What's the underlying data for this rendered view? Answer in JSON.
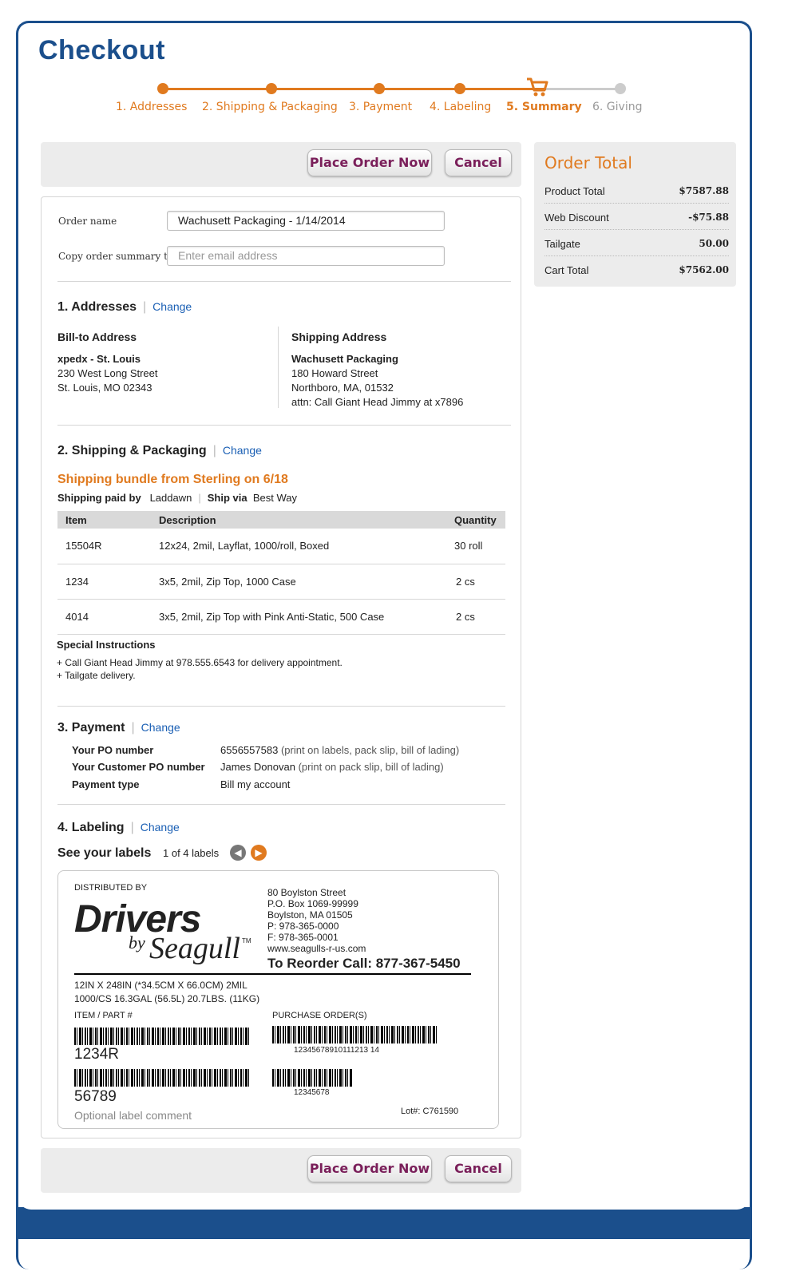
{
  "page": {
    "title": "Checkout"
  },
  "steps": [
    {
      "label": "1. Addresses",
      "state": "done"
    },
    {
      "label": "2. Shipping & Packaging",
      "state": "done"
    },
    {
      "label": "3. Payment",
      "state": "done"
    },
    {
      "label": "4. Labeling",
      "state": "done"
    },
    {
      "label": "5. Summary",
      "state": "active"
    },
    {
      "label": "6. Giving",
      "state": "todo"
    }
  ],
  "actions": {
    "place_order": "Place Order Now",
    "cancel": "Cancel"
  },
  "order": {
    "name_label": "Order name",
    "name_value": "Wachusett Packaging - 1/14/2014",
    "copy_label": "Copy order summary to",
    "email_placeholder": "Enter email address"
  },
  "addresses": {
    "heading": "1. Addresses",
    "change": "Change",
    "bill_to": {
      "title": "Bill-to Address",
      "name": "xpedx - St. Louis",
      "line1": "230 West Long Street",
      "line2": "St. Louis, MO 02343"
    },
    "ship_to": {
      "title": "Shipping Address",
      "name": "Wachusett Packaging",
      "line1": "180 Howard Street",
      "line2": "Northboro, MA, 01532",
      "line3": "attn: Call Giant Head Jimmy at x7896"
    }
  },
  "shipping": {
    "heading": "2. Shipping & Packaging",
    "change": "Change",
    "bundle_title": "Shipping bundle from Sterling on 6/18",
    "paid_by_label": "Shipping paid by",
    "paid_by_value": "Laddawn",
    "ship_via_label": "Ship via",
    "ship_via_value": "Best Way",
    "columns": [
      "Item",
      "Description",
      "Quantity"
    ],
    "rows": [
      [
        "15504R",
        "12x24, 2mil, Layflat, 1000/roll, Boxed",
        "30 roll"
      ],
      [
        "1234",
        "3x5, 2mil, Zip Top, 1000 Case",
        "2 cs"
      ],
      [
        "4014",
        "3x5, 2mil, Zip Top with Pink Anti-Static, 500 Case",
        "2 cs"
      ]
    ],
    "instructions_title": "Special Instructions",
    "instructions_1": "+ Call Giant Head Jimmy at 978.555.6543 for delivery appointment.",
    "instructions_2": "+ Tailgate delivery."
  },
  "payment": {
    "heading": "3. Payment",
    "change": "Change",
    "po_label": "Your PO number",
    "po_value": "6556557583",
    "po_note": "(print on labels, pack slip, bill of lading)",
    "cust_po_label": "Your Customer PO number",
    "cust_po_value": "James Donovan",
    "cust_po_note": "(print on pack slip, bill of lading)",
    "type_label": "Payment type",
    "type_value": "Bill my account"
  },
  "labeling": {
    "heading": "4. Labeling",
    "change": "Change",
    "see_labels": "See your labels",
    "pager": "1 of 4 labels",
    "card": {
      "distributed_by": "DISTRIBUTED BY",
      "brand_main": "Drivers",
      "brand_by": "by",
      "brand_sub": "Seagull",
      "tm": "TM",
      "addr1": "80 Boylston Street",
      "addr2": "P.O. Box 1069-99999",
      "addr3": "Boylston, MA  01505",
      "phone": "P: 978-365-0000",
      "fax": "F: 978-365-0001",
      "web": "www.seagulls-r-us.com",
      "reorder": "To Reorder Call: 877-367-5450",
      "spec1": "12IN X 248IN (*34.5CM X 66.0CM)  2MIL",
      "spec2": "1000/CS  16.3GAL (56.5L) 20.7LBS. (11KG)",
      "item_label": "ITEM / PART #",
      "po_label": "PURCHASE ORDER(S)",
      "item_code": "1234R",
      "po_code": "12345678910111213 14",
      "item_code2": "56789",
      "po_code2": "12345678",
      "comment": "Optional label comment",
      "lot": "Lot#: C761590"
    }
  },
  "totals": {
    "title": "Order Total",
    "rows": [
      {
        "k": "Product Total",
        "v": "$7587.88"
      },
      {
        "k": "Web Discount",
        "v": "-$75.88"
      },
      {
        "k": "Tailgate",
        "v": "50.00"
      },
      {
        "k": "Cart Total",
        "v": "$7562.00"
      }
    ]
  },
  "colors": {
    "brand_blue": "#1b4f8c",
    "accent_orange": "#e07a1f",
    "button_text": "#7a1f5a",
    "link": "#1a5fb4"
  }
}
